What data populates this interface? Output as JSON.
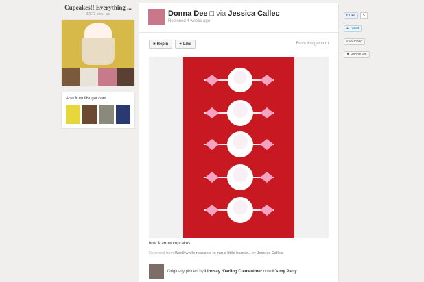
{
  "board": {
    "title": "Cupcakes!! Everything ...",
    "meta": "32573 pins",
    "also_title": "Also from lilsugar.com"
  },
  "pin": {
    "user": "Donna Dee □",
    "via": "via",
    "via_user": "Jessica Callec",
    "repinned": "Repinned 4 weeks ago",
    "repin_label": "Repin",
    "like_label": "Like",
    "from": "From lilsugar.com",
    "caption": "bow & arrow cupcakes",
    "repinned_from_prefix": "Repinned from",
    "repinned_from_board": "Worthwhile reason's to run a little harder...",
    "repinned_from_by": "by",
    "repinned_from_user": "Jessica Callec",
    "orig_prefix": "Originally pinned by",
    "orig_user": "Lindsay *Darling Clementine*",
    "orig_onto": "onto",
    "orig_board": "It's my Party"
  },
  "social": {
    "like_label": "Like",
    "like_count": "5",
    "tweet_label": "Tweet",
    "embed_label": "<> Embed",
    "report_label": "Report Pin"
  },
  "colors": {
    "photo_bg": "#c81922",
    "link": "#3b5998"
  }
}
